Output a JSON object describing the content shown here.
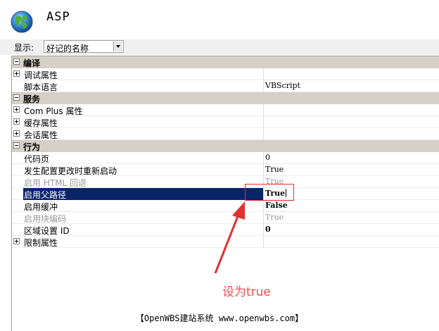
{
  "header": {
    "title": "ASP",
    "icon": "globe-icon"
  },
  "display": {
    "label": "显示:",
    "selected": "好记的名称"
  },
  "groups": [
    {
      "label": "编译",
      "items": [
        {
          "name": "调试属性",
          "value": "",
          "expandable": true
        },
        {
          "name": "脚本语言",
          "value": "VBScript"
        }
      ]
    },
    {
      "label": "服务",
      "items": [
        {
          "name": "Com Plus 属性",
          "value": "",
          "expandable": true
        },
        {
          "name": "缓存属性",
          "value": "",
          "expandable": true
        },
        {
          "name": "会话属性",
          "value": "",
          "expandable": true
        }
      ]
    },
    {
      "label": "行为",
      "items": [
        {
          "name": "代码页",
          "value": "0"
        },
        {
          "name": "发生配置更改时重新启动",
          "value": "True"
        },
        {
          "name": "启用 HTML 回退",
          "value": "True",
          "disabled": true
        },
        {
          "name": "启用父路径",
          "value": "True",
          "selected": true
        },
        {
          "name": "启用缓冲",
          "value": "False",
          "bold": true
        },
        {
          "name": "启用块编码",
          "value": "True",
          "disabled": true
        },
        {
          "name": "区域设置 ID",
          "value": "0",
          "bold": true
        },
        {
          "name": "限制属性",
          "value": "",
          "expandable": true
        }
      ]
    }
  ],
  "annotation": {
    "text": "设为true",
    "color": "#ff4a4a"
  },
  "footer": {
    "text": "【OpenWBS建站系统 www.openwbs.com】"
  },
  "colors": {
    "selection": "#0a246a",
    "category_bg": "#d4d0c8",
    "highlight": "#e03030"
  }
}
